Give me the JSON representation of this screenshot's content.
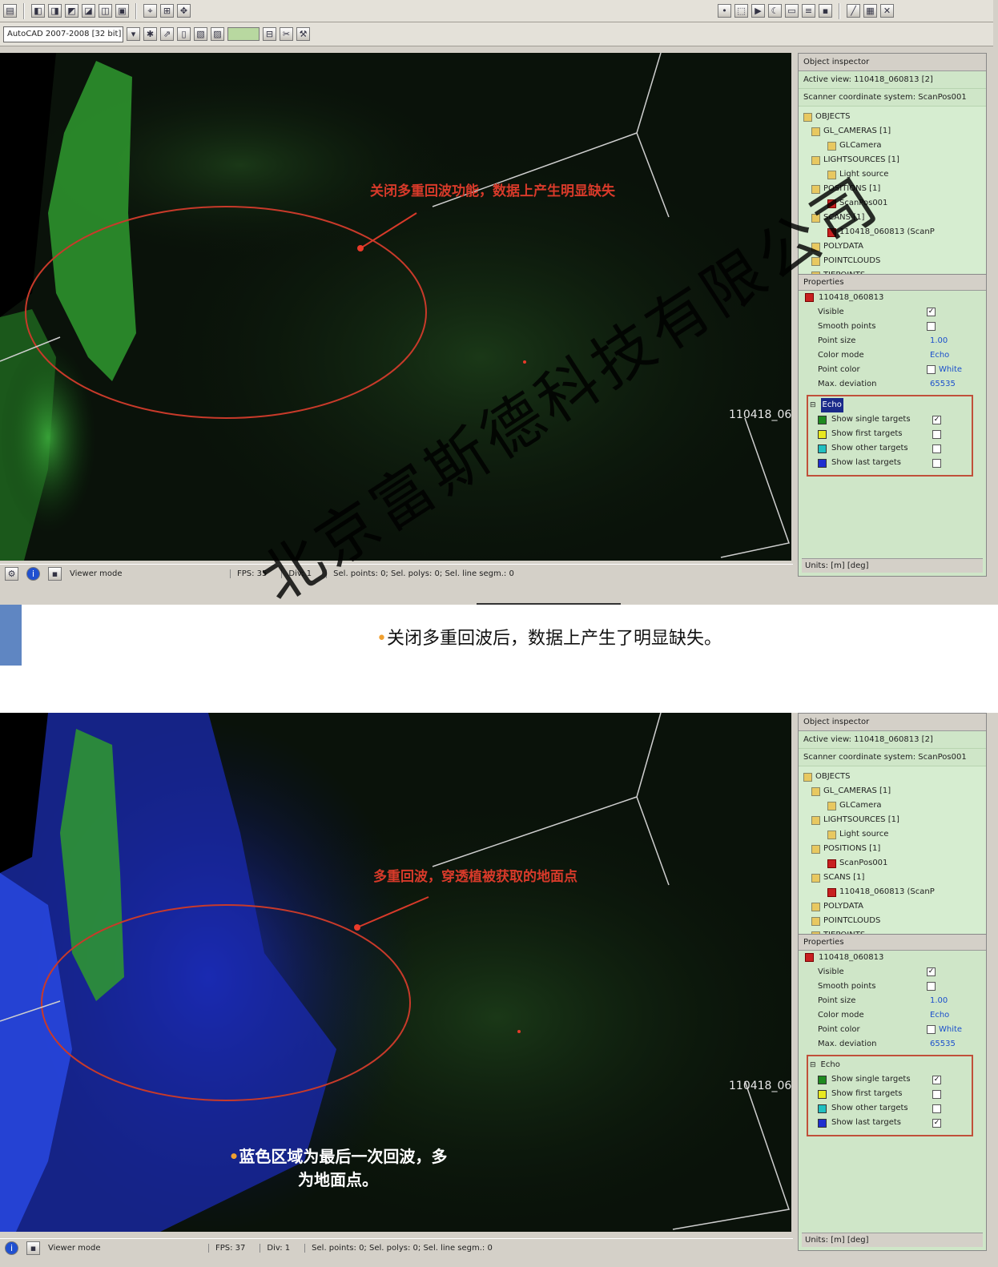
{
  "top": {
    "toolbar2": {
      "cad_version": "AutoCAD 2007-2008 [32 bit]"
    },
    "annotation": "关闭多重回波功能，数据上产生明显缺失",
    "scan_label": "110418_06",
    "status": {
      "mode": "Viewer mode",
      "fps": "FPS: 35",
      "div": "Div: 1",
      "selection": "Sel. points: 0; Sel. polys: 0; Sel. line segm.: 0"
    },
    "inspector": {
      "title": "Object inspector",
      "active_view": "Active view: 110418_060813 [2]",
      "coord_system": "Scanner coordinate system: ScanPos001",
      "tree": [
        {
          "label": "OBJECTS",
          "indent": 0
        },
        {
          "label": "GL_CAMERAS [1]",
          "indent": 1
        },
        {
          "label": "GLCamera",
          "indent": 3
        },
        {
          "label": "LIGHTSOURCES [1]",
          "indent": 1
        },
        {
          "label": "Light source",
          "indent": 3
        },
        {
          "label": "POSITIONS [1]",
          "indent": 1
        },
        {
          "label": "ScanPos001",
          "indent": 3,
          "red": true
        },
        {
          "label": "SCANS [1]",
          "indent": 1
        },
        {
          "label": "110418_060813 (ScanP",
          "indent": 3,
          "red": true
        },
        {
          "label": "POLYDATA",
          "indent": 1
        },
        {
          "label": "POINTCLOUDS",
          "indent": 1
        },
        {
          "label": "TIEPOINTS",
          "indent": 1
        }
      ],
      "properties_title": "Properties",
      "object_name": "110418_060813",
      "props": [
        {
          "name": "Visible",
          "value": "",
          "check": "✓"
        },
        {
          "name": "Smooth points",
          "value": "",
          "check": " "
        },
        {
          "name": "Point size",
          "value": "1.00"
        },
        {
          "name": "Color mode",
          "value": "Echo"
        },
        {
          "name": "Point color",
          "value": "White",
          "check": " "
        },
        {
          "name": "Max. deviation",
          "value": "65535"
        }
      ],
      "echo_title": "Echo",
      "echo": [
        {
          "label": "Show single targets",
          "color": "#1f8a1f",
          "checked": "✓"
        },
        {
          "label": "Show first targets",
          "color": "#e8e820",
          "checked": " "
        },
        {
          "label": "Show other targets",
          "color": "#20c0c0",
          "checked": " "
        },
        {
          "label": "Show last targets",
          "color": "#1f2fd0",
          "checked": " "
        }
      ],
      "units": "Units: [m] [deg]"
    }
  },
  "caption": "关闭多重回波后，数据上产生了明显缺失。",
  "bottom": {
    "annotation": "多重回波，穿透植被获取的地面点",
    "note_line1": "蓝色区域为最后一次回波，多",
    "note_line2": "为地面点。",
    "scan_label": "110418_06",
    "status": {
      "mode": "Viewer mode",
      "fps": "FPS: 37",
      "div": "Div: 1",
      "selection": "Sel. points: 0; Sel. polys: 0; Sel. line segm.: 0"
    },
    "inspector": {
      "title": "Object inspector",
      "active_view": "Active view: 110418_060813 [2]",
      "coord_system": "Scanner coordinate system: ScanPos001",
      "tree": [
        {
          "label": "OBJECTS",
          "indent": 0
        },
        {
          "label": "GL_CAMERAS [1]",
          "indent": 1
        },
        {
          "label": "GLCamera",
          "indent": 3
        },
        {
          "label": "LIGHTSOURCES [1]",
          "indent": 1
        },
        {
          "label": "Light source",
          "indent": 3
        },
        {
          "label": "POSITIONS [1]",
          "indent": 1
        },
        {
          "label": "ScanPos001",
          "indent": 3,
          "red": true
        },
        {
          "label": "SCANS [1]",
          "indent": 1
        },
        {
          "label": "110418_060813 (ScanP",
          "indent": 3,
          "red": true
        },
        {
          "label": "POLYDATA",
          "indent": 1
        },
        {
          "label": "POINTCLOUDS",
          "indent": 1
        },
        {
          "label": "TIEPOINTS",
          "indent": 1
        }
      ],
      "properties_title": "Properties",
      "object_name": "110418_060813",
      "props": [
        {
          "name": "Visible",
          "value": "",
          "check": "✓"
        },
        {
          "name": "Smooth points",
          "value": "",
          "check": " "
        },
        {
          "name": "Point size",
          "value": "1.00"
        },
        {
          "name": "Color mode",
          "value": "Echo"
        },
        {
          "name": "Point color",
          "value": "White",
          "check": " "
        },
        {
          "name": "Max. deviation",
          "value": "65535"
        }
      ],
      "echo_title": "Echo",
      "echo": [
        {
          "label": "Show single targets",
          "color": "#1f8a1f",
          "checked": "✓"
        },
        {
          "label": "Show first targets",
          "color": "#e8e820",
          "checked": " "
        },
        {
          "label": "Show other targets",
          "color": "#20c0c0",
          "checked": " "
        },
        {
          "label": "Show last targets",
          "color": "#1f2fd0",
          "checked": "✓"
        }
      ],
      "units": "Units: [m] [deg]"
    }
  },
  "watermark": "北京富斯德科技有限公司"
}
